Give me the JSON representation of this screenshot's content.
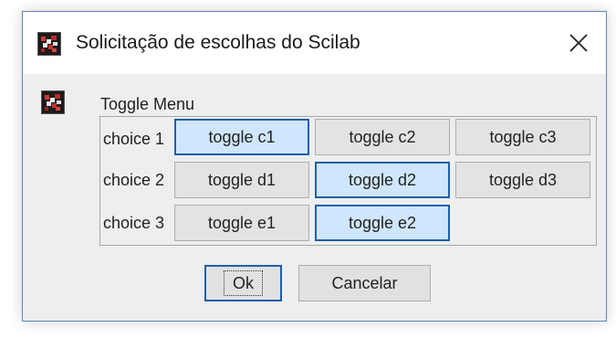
{
  "window": {
    "title": "Solicitação de escolhas do Scilab",
    "app_icon": "scilab-icon",
    "close_icon": "close-icon"
  },
  "content": {
    "icon": "scilab-icon",
    "menu_label": "Toggle Menu"
  },
  "choices": [
    {
      "label": "choice 1",
      "options": [
        "toggle c1",
        "toggle c2",
        "toggle c3"
      ],
      "selected": "toggle c1"
    },
    {
      "label": "choice 2",
      "options": [
        "toggle d1",
        "toggle d2",
        "toggle d3"
      ],
      "selected": "toggle d2"
    },
    {
      "label": "choice 3",
      "options": [
        "toggle e1",
        "toggle e2"
      ],
      "selected": "toggle e2"
    }
  ],
  "buttons": {
    "ok_label": "Ok",
    "cancel_label": "Cancelar"
  },
  "colors": {
    "selected_fill": "#cfe6fc",
    "selected_border": "#1e5fa8",
    "window_border": "#5a87bd"
  }
}
